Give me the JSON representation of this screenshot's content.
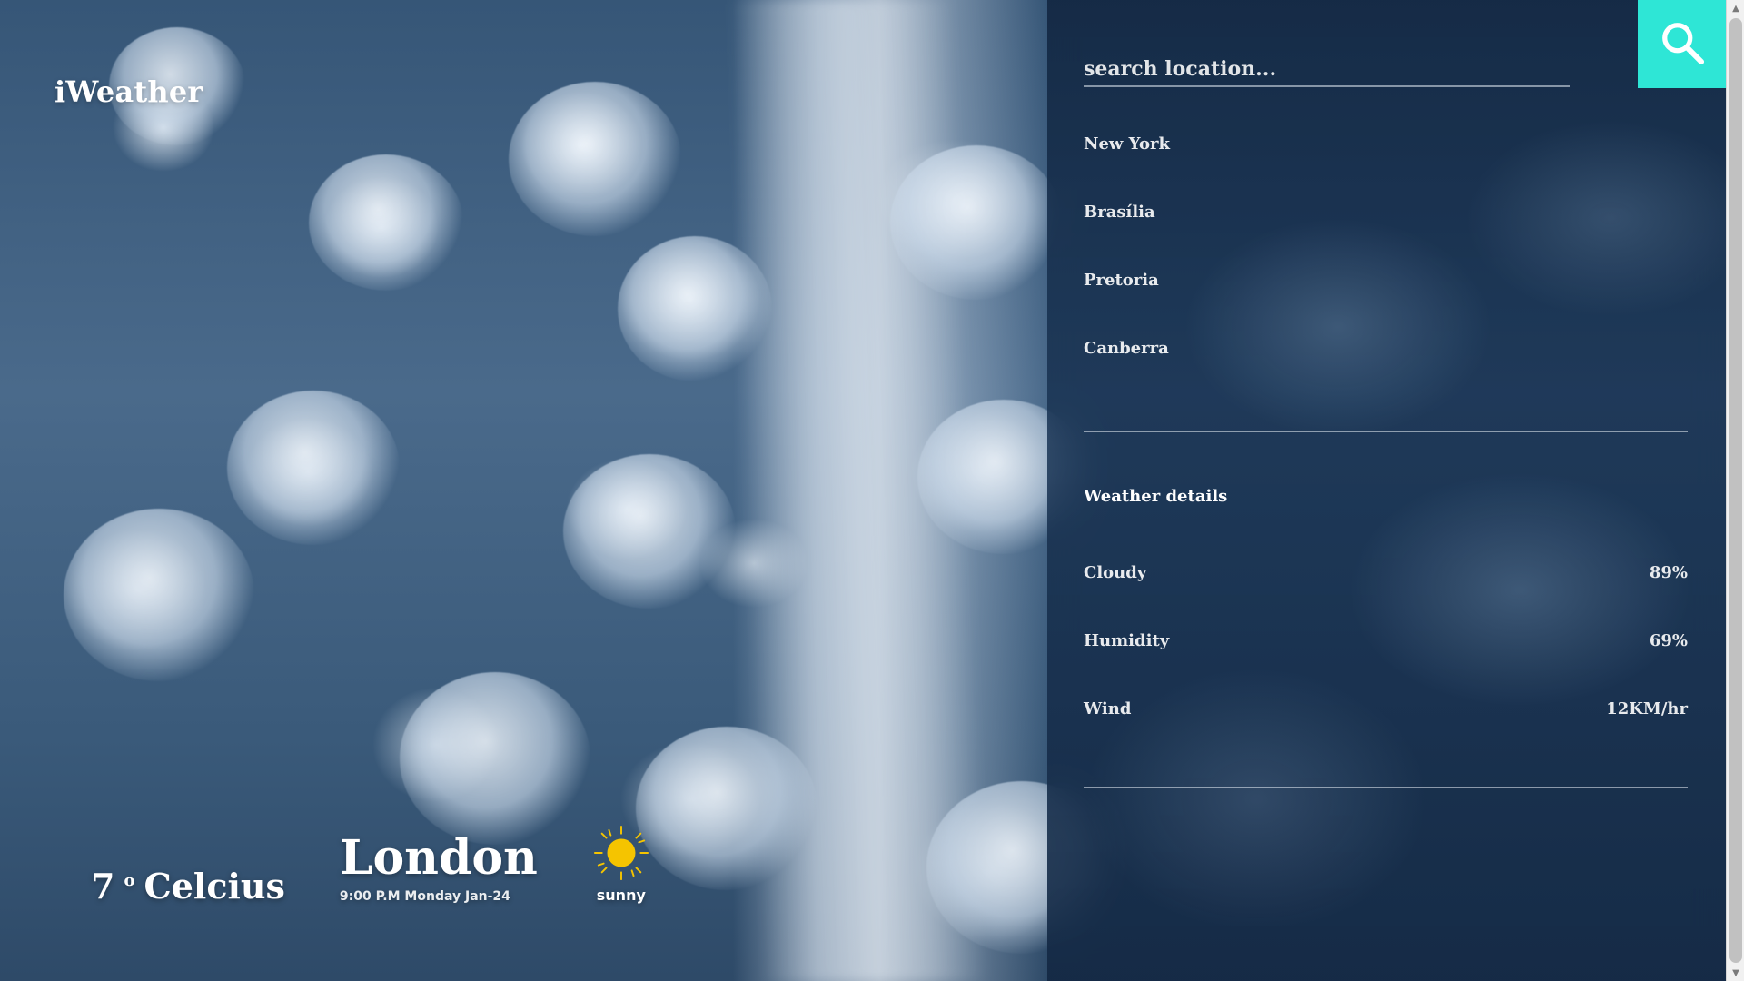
{
  "app": {
    "brand": "iWeather"
  },
  "current": {
    "temp_value": "7",
    "temp_degree": "o",
    "temp_unit": "Celcius",
    "city": "London",
    "datetime": "9:00 P.M Monday Jan-24",
    "condition": "sunny",
    "condition_icon": "sun-icon"
  },
  "search": {
    "placeholder": "search location...",
    "value": "",
    "button_icon": "search-icon"
  },
  "locations": [
    {
      "label": "New York"
    },
    {
      "label": "Brasília"
    },
    {
      "label": "Pretoria"
    },
    {
      "label": "Canberra"
    }
  ],
  "details": {
    "title": "Weather details",
    "rows": [
      {
        "label": "Cloudy",
        "value": "89%"
      },
      {
        "label": "Humidity",
        "value": "69%"
      },
      {
        "label": "Wind",
        "value": "12KM/hr"
      }
    ]
  },
  "colors": {
    "accent": "#2ee6d6",
    "sun": "#f5c400"
  },
  "scrollbar": {
    "up_glyph": "▲",
    "down_glyph": "▼"
  }
}
